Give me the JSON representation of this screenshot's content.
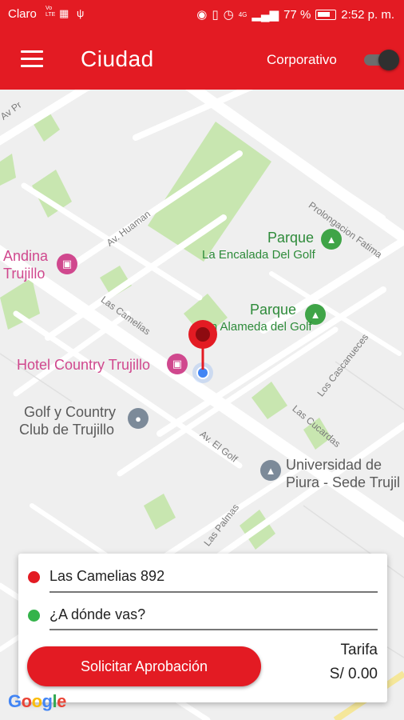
{
  "status_bar": {
    "carrier": "Claro",
    "network": "Vo LTE",
    "signal": "4G",
    "battery": "77 %",
    "time": "2:52 p. m."
  },
  "app_bar": {
    "title": "Ciudad",
    "corporate_label": "Corporativo",
    "corporate_toggle_on": false
  },
  "map": {
    "pois": {
      "andina_1": "Andina",
      "andina_2": "Trujillo",
      "hotel": "Hotel Country Trujillo",
      "golf_1": "Golf y Country",
      "golf_2": "Club de Trujillo",
      "parque1_title": "Parque",
      "parque1_name": "La Encalada Del Golf",
      "parque2_title": "Parque",
      "parque2_name": "Un Alameda del Golf",
      "univ_1": "Universidad de",
      "univ_2": "Piura - Sede Trujil"
    },
    "streets": {
      "av_pr": "Av Pr",
      "av_huaman": "Av. Huaman",
      "prolongacion": "Prolongacion Fatima",
      "las_camelias": "Las Camelias",
      "los_cascanueces": "Los Cascanueces",
      "las_cucardas": "Las Cucardas",
      "av_el_golf": "Av. El Golf",
      "las_palmas": "Las Palmas"
    },
    "attribution": "Google"
  },
  "trip": {
    "origin": "Las Camelias 892",
    "destination_placeholder": "¿A dónde vas?",
    "request_button": "Solicitar Aprobación",
    "fare_label": "Tarifa",
    "fare_value": "S/ 0.00"
  },
  "colors": {
    "brand_red": "#e31b23",
    "park_green": "#c8e6b0",
    "origin_dot": "#e31b23",
    "destination_dot": "#34b34a"
  }
}
